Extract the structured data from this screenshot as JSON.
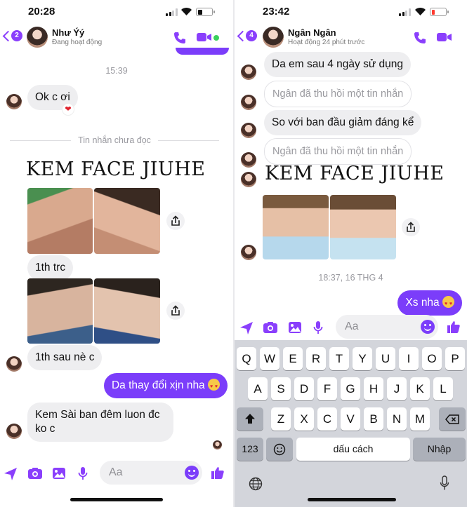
{
  "left": {
    "status": {
      "time": "20:28"
    },
    "header": {
      "back_count": "2",
      "name": "Như Ýý",
      "status": "Đang hoạt động"
    },
    "timestamp": "15:39",
    "unread_label": "Tin nhắn chưa đọc",
    "messages": {
      "ok": "Ok c ơi",
      "reaction": "❤",
      "before": "1th trc",
      "after": "1th sau nè c",
      "sent": "Da thay đổi xịn nha",
      "question": "Kem Sài ban đêm luon đc ko c"
    },
    "banner": "KEM FACE JIUHE",
    "composer": {
      "placeholder": "Aa"
    }
  },
  "right": {
    "status": {
      "time": "23:42"
    },
    "header": {
      "back_count": "4",
      "name": "Ngân Ngân",
      "status": "Hoạt động 24 phút trước"
    },
    "messages": {
      "m1": "Da em sau 4 ngày sử dụng",
      "recalled1": "Ngân đã thu hồi một tin nhắn",
      "m2": "So với ban đầu giảm đáng kể",
      "recalled2": "Ngân đã thu hồi một tin nhắn",
      "sent": "Xs nha"
    },
    "banner": "KEM FACE JIUHE",
    "timestamp": "18:37, 16 THG 4",
    "composer": {
      "placeholder": "Aa"
    },
    "keyboard": {
      "row1": [
        "Q",
        "W",
        "E",
        "R",
        "T",
        "Y",
        "U",
        "I",
        "O",
        "P"
      ],
      "row2": [
        "A",
        "S",
        "D",
        "F",
        "G",
        "H",
        "J",
        "K",
        "L"
      ],
      "row3": [
        "Z",
        "X",
        "C",
        "V",
        "B",
        "N",
        "M"
      ],
      "numbers": "123",
      "space": "dấu cách",
      "return": "Nhập"
    }
  },
  "colors": {
    "accent": "#7b3dfa",
    "incoming": "#eeeef0",
    "keyboard": "#d3d5db"
  }
}
